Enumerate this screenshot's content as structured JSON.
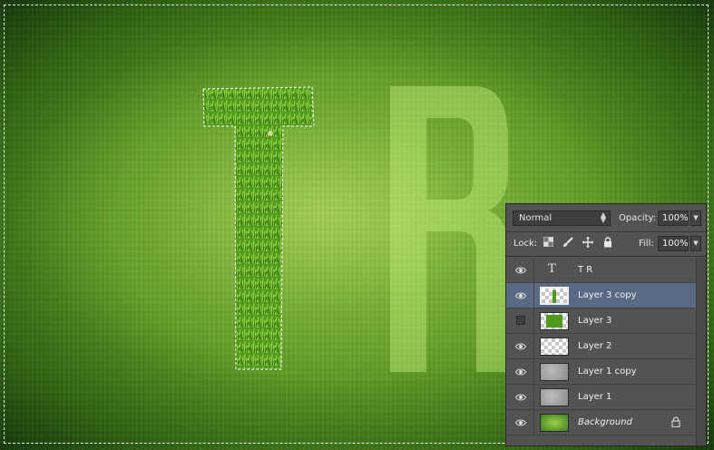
{
  "canvas": {
    "letters": [
      "T",
      "R"
    ]
  },
  "layers_panel": {
    "blend_mode": "Normal",
    "opacity_label": "Opacity:",
    "opacity_value": "100%",
    "lock_label": "Lock:",
    "fill_label": "Fill:",
    "fill_value": "100%",
    "lock_icons": [
      "lock-transparent-icon",
      "lock-paint-icon",
      "lock-move-icon",
      "lock-all-icon"
    ],
    "layers": [
      {
        "name": "T R",
        "kind": "text",
        "visible": true,
        "selected": false
      },
      {
        "name": "Layer 3 copy",
        "kind": "grass",
        "visible": true,
        "selected": true
      },
      {
        "name": "Layer 3",
        "kind": "grass",
        "visible": false,
        "selected": false
      },
      {
        "name": "Layer 2",
        "kind": "transparent",
        "visible": true,
        "selected": false
      },
      {
        "name": "Layer 1 copy",
        "kind": "texture",
        "visible": true,
        "selected": false
      },
      {
        "name": "Layer 1",
        "kind": "texture",
        "visible": true,
        "selected": false
      },
      {
        "name": "Background",
        "kind": "background",
        "visible": true,
        "selected": false,
        "locked": true
      }
    ]
  },
  "colors": {
    "selection_highlight": "#5a6a84",
    "panel_bg": "#535353",
    "grass_green": "#4f9a1c"
  }
}
